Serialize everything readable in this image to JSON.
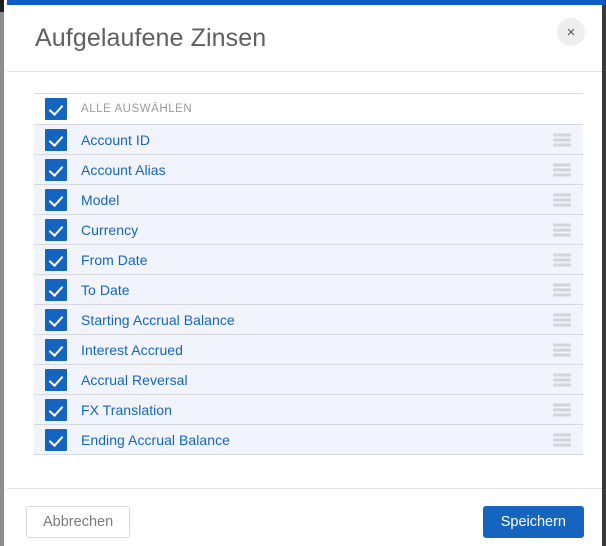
{
  "window": {
    "accent_color": "#0d5bc4"
  },
  "header": {
    "title": "Aufgelaufene Zinsen",
    "close_label": "×",
    "close_icon": "close-icon"
  },
  "list": {
    "select_all": {
      "label": "ALLE AUSWÄHLEN",
      "checked": true,
      "has_handle": false
    },
    "items": [
      {
        "label": "Account ID",
        "checked": true,
        "has_handle": true
      },
      {
        "label": "Account Alias",
        "checked": true,
        "has_handle": true
      },
      {
        "label": "Model",
        "checked": true,
        "has_handle": true
      },
      {
        "label": "Currency",
        "checked": true,
        "has_handle": true
      },
      {
        "label": "From Date",
        "checked": true,
        "has_handle": true
      },
      {
        "label": "To Date",
        "checked": true,
        "has_handle": true
      },
      {
        "label": "Starting Accrual Balance",
        "checked": true,
        "has_handle": true
      },
      {
        "label": "Interest Accrued",
        "checked": true,
        "has_handle": true
      },
      {
        "label": "Accrual Reversal",
        "checked": true,
        "has_handle": true
      },
      {
        "label": "FX Translation",
        "checked": true,
        "has_handle": true
      },
      {
        "label": "Ending Accrual Balance",
        "checked": true,
        "has_handle": true
      }
    ]
  },
  "footer": {
    "cancel_label": "Abbrechen",
    "save_label": "Speichern",
    "save_color": "#1565c0"
  },
  "colors": {
    "accent_blue": "#1565c0",
    "row_background": "#f1f4fc",
    "label_blue": "#1565c0",
    "muted_gray": "#9a9a9a"
  }
}
